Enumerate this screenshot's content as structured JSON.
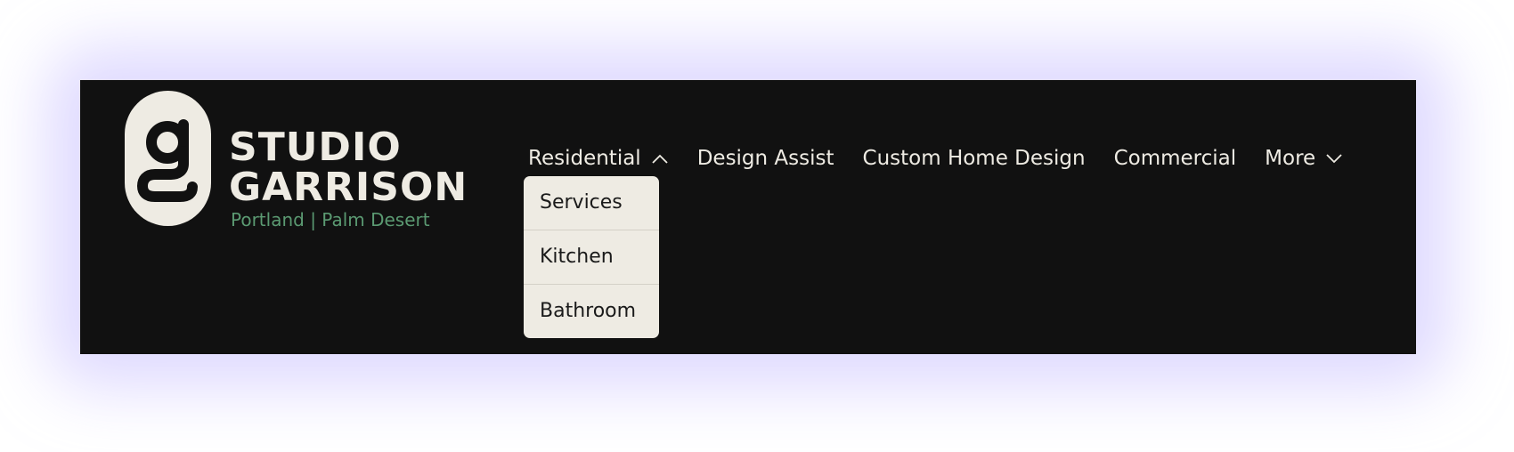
{
  "brand": {
    "logo_letter": "g",
    "name_line1": "STUDIO",
    "name_line2": "GARRISON",
    "tagline": "Portland | Palm Desert"
  },
  "nav": {
    "items": [
      {
        "label": "Residential",
        "icon": "chevron-up-icon",
        "expanded": true
      },
      {
        "label": "Design Assist"
      },
      {
        "label": "Custom Home Design"
      },
      {
        "label": "Commercial"
      },
      {
        "label": "More",
        "icon": "chevron-down-icon",
        "expanded": false
      }
    ]
  },
  "dropdown": {
    "items": [
      {
        "label": "Services"
      },
      {
        "label": "Kitchen"
      },
      {
        "label": "Bathroom"
      }
    ]
  },
  "colors": {
    "header_background": "#111111",
    "text_light": "#eeebe3",
    "tagline_green": "#5b9a72",
    "dropdown_background": "#eeebe3",
    "glow": "#c4bcff"
  }
}
